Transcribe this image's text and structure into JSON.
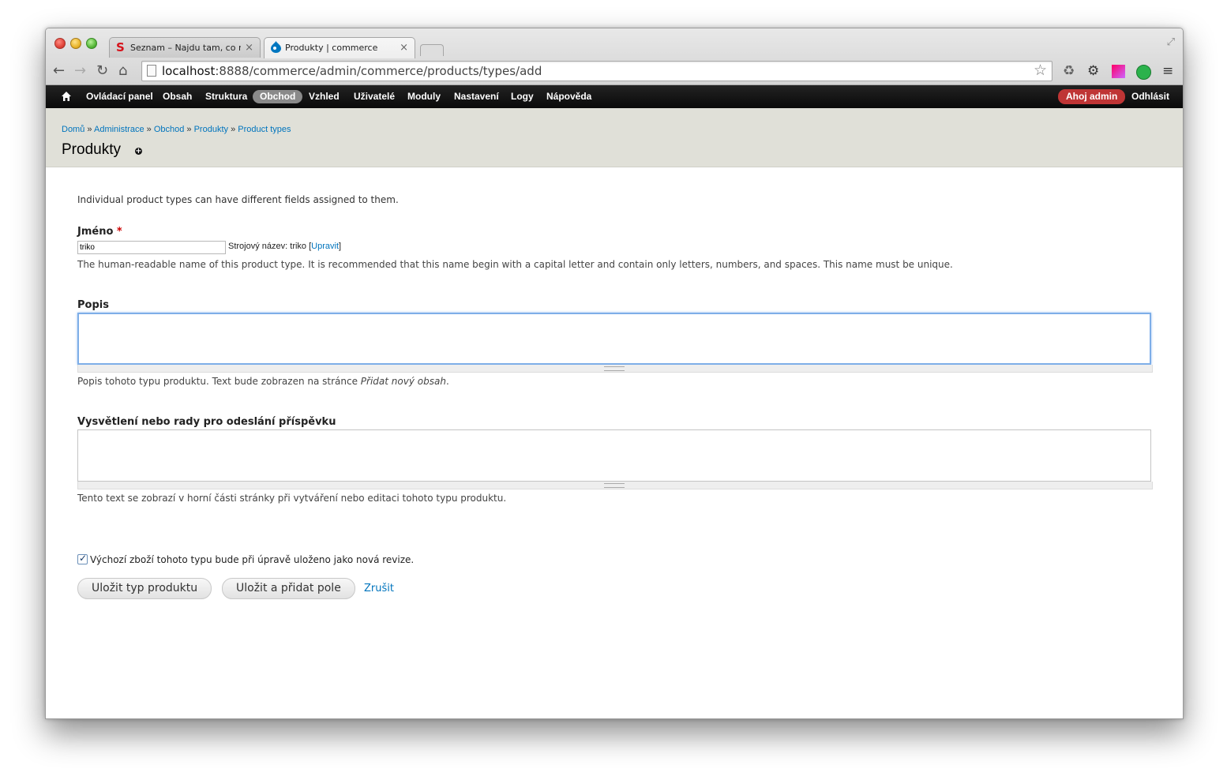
{
  "browser": {
    "tabs": [
      {
        "title": "Seznam – Najdu tam, co neznám",
        "favicon": "seznam-s-icon",
        "color": "#d6121b",
        "active": false
      },
      {
        "title": "Produkty | commerce",
        "favicon": "drupal-drop-icon",
        "color": "#0077c0",
        "active": true
      }
    ],
    "url_host": "localhost",
    "url_path": ":8888/commerce/admin/commerce/products/types/add",
    "tab_close": "×"
  },
  "admin_menu": {
    "items": [
      "Ovládací panel",
      "Obsah",
      "Struktura",
      "Obchod",
      "Vzhled",
      "Uživatelé",
      "Moduly",
      "Nastavení",
      "Logy",
      "Nápověda"
    ],
    "active": "Obchod",
    "greeting": "Ahoj admin",
    "logout": "Odhlásit"
  },
  "breadcrumb": [
    "Domů",
    "Administrace",
    "Obchod",
    "Produkty",
    "Product types"
  ],
  "breadcrumb_sep": "»",
  "page_title": "Produkty",
  "form": {
    "intro": "Individual product types can have different fields assigned to them.",
    "name_label": "Jméno",
    "required_mark": "*",
    "name_value": "triko",
    "machine_name_prefix": "Strojový název: triko [",
    "machine_name_edit": "Upravit",
    "machine_name_suffix": "]",
    "name_help": "The human-readable name of this product type. It is recommended that this name begin with a capital letter and contain only letters, numbers, and spaces. This name must be unique.",
    "description_label": "Popis",
    "description_help_prefix": "Popis tohoto typu produktu. Text bude zobrazen na stránce ",
    "description_help_em": "Přidat nový obsah",
    "description_help_suffix": ".",
    "help_label": "Vysvětlení nebo rady pro odeslání příspěvku",
    "help_help": "Tento text se zobrazí v horní části stránky při vytváření nebo editaci tohoto typu produktu.",
    "revision_label": "Výchozí zboží tohoto typu bude při úpravě uloženo jako nová revize.",
    "revision_checked": true,
    "save_button": "Uložit typ produktu",
    "save_add_button": "Uložit a přidat pole",
    "cancel_link": "Zrušit"
  }
}
